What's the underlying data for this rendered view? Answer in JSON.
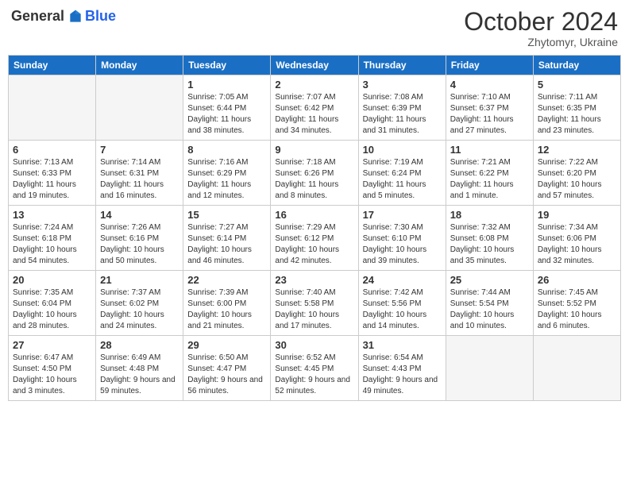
{
  "header": {
    "logo_general": "General",
    "logo_blue": "Blue",
    "month": "October 2024",
    "location": "Zhytomyr, Ukraine"
  },
  "days_of_week": [
    "Sunday",
    "Monday",
    "Tuesday",
    "Wednesday",
    "Thursday",
    "Friday",
    "Saturday"
  ],
  "weeks": [
    [
      {
        "day": "",
        "info": ""
      },
      {
        "day": "",
        "info": ""
      },
      {
        "day": "1",
        "info": "Sunrise: 7:05 AM\nSunset: 6:44 PM\nDaylight: 11 hours and 38 minutes."
      },
      {
        "day": "2",
        "info": "Sunrise: 7:07 AM\nSunset: 6:42 PM\nDaylight: 11 hours and 34 minutes."
      },
      {
        "day": "3",
        "info": "Sunrise: 7:08 AM\nSunset: 6:39 PM\nDaylight: 11 hours and 31 minutes."
      },
      {
        "day": "4",
        "info": "Sunrise: 7:10 AM\nSunset: 6:37 PM\nDaylight: 11 hours and 27 minutes."
      },
      {
        "day": "5",
        "info": "Sunrise: 7:11 AM\nSunset: 6:35 PM\nDaylight: 11 hours and 23 minutes."
      }
    ],
    [
      {
        "day": "6",
        "info": "Sunrise: 7:13 AM\nSunset: 6:33 PM\nDaylight: 11 hours and 19 minutes."
      },
      {
        "day": "7",
        "info": "Sunrise: 7:14 AM\nSunset: 6:31 PM\nDaylight: 11 hours and 16 minutes."
      },
      {
        "day": "8",
        "info": "Sunrise: 7:16 AM\nSunset: 6:29 PM\nDaylight: 11 hours and 12 minutes."
      },
      {
        "day": "9",
        "info": "Sunrise: 7:18 AM\nSunset: 6:26 PM\nDaylight: 11 hours and 8 minutes."
      },
      {
        "day": "10",
        "info": "Sunrise: 7:19 AM\nSunset: 6:24 PM\nDaylight: 11 hours and 5 minutes."
      },
      {
        "day": "11",
        "info": "Sunrise: 7:21 AM\nSunset: 6:22 PM\nDaylight: 11 hours and 1 minute."
      },
      {
        "day": "12",
        "info": "Sunrise: 7:22 AM\nSunset: 6:20 PM\nDaylight: 10 hours and 57 minutes."
      }
    ],
    [
      {
        "day": "13",
        "info": "Sunrise: 7:24 AM\nSunset: 6:18 PM\nDaylight: 10 hours and 54 minutes."
      },
      {
        "day": "14",
        "info": "Sunrise: 7:26 AM\nSunset: 6:16 PM\nDaylight: 10 hours and 50 minutes."
      },
      {
        "day": "15",
        "info": "Sunrise: 7:27 AM\nSunset: 6:14 PM\nDaylight: 10 hours and 46 minutes."
      },
      {
        "day": "16",
        "info": "Sunrise: 7:29 AM\nSunset: 6:12 PM\nDaylight: 10 hours and 42 minutes."
      },
      {
        "day": "17",
        "info": "Sunrise: 7:30 AM\nSunset: 6:10 PM\nDaylight: 10 hours and 39 minutes."
      },
      {
        "day": "18",
        "info": "Sunrise: 7:32 AM\nSunset: 6:08 PM\nDaylight: 10 hours and 35 minutes."
      },
      {
        "day": "19",
        "info": "Sunrise: 7:34 AM\nSunset: 6:06 PM\nDaylight: 10 hours and 32 minutes."
      }
    ],
    [
      {
        "day": "20",
        "info": "Sunrise: 7:35 AM\nSunset: 6:04 PM\nDaylight: 10 hours and 28 minutes."
      },
      {
        "day": "21",
        "info": "Sunrise: 7:37 AM\nSunset: 6:02 PM\nDaylight: 10 hours and 24 minutes."
      },
      {
        "day": "22",
        "info": "Sunrise: 7:39 AM\nSunset: 6:00 PM\nDaylight: 10 hours and 21 minutes."
      },
      {
        "day": "23",
        "info": "Sunrise: 7:40 AM\nSunset: 5:58 PM\nDaylight: 10 hours and 17 minutes."
      },
      {
        "day": "24",
        "info": "Sunrise: 7:42 AM\nSunset: 5:56 PM\nDaylight: 10 hours and 14 minutes."
      },
      {
        "day": "25",
        "info": "Sunrise: 7:44 AM\nSunset: 5:54 PM\nDaylight: 10 hours and 10 minutes."
      },
      {
        "day": "26",
        "info": "Sunrise: 7:45 AM\nSunset: 5:52 PM\nDaylight: 10 hours and 6 minutes."
      }
    ],
    [
      {
        "day": "27",
        "info": "Sunrise: 6:47 AM\nSunset: 4:50 PM\nDaylight: 10 hours and 3 minutes."
      },
      {
        "day": "28",
        "info": "Sunrise: 6:49 AM\nSunset: 4:48 PM\nDaylight: 9 hours and 59 minutes."
      },
      {
        "day": "29",
        "info": "Sunrise: 6:50 AM\nSunset: 4:47 PM\nDaylight: 9 hours and 56 minutes."
      },
      {
        "day": "30",
        "info": "Sunrise: 6:52 AM\nSunset: 4:45 PM\nDaylight: 9 hours and 52 minutes."
      },
      {
        "day": "31",
        "info": "Sunrise: 6:54 AM\nSunset: 4:43 PM\nDaylight: 9 hours and 49 minutes."
      },
      {
        "day": "",
        "info": ""
      },
      {
        "day": "",
        "info": ""
      }
    ]
  ]
}
